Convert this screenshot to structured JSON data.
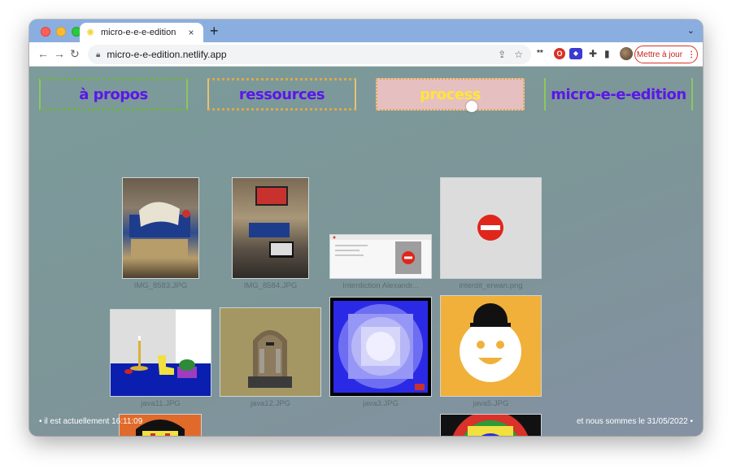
{
  "browser": {
    "tab_title": "micro-e-e-e-edition",
    "new_tab_symbol": "+",
    "url": "micro-e-e-edition.netlify.app",
    "update_button": "Mettre à jour"
  },
  "nav": {
    "items": [
      {
        "label": "à propos"
      },
      {
        "label": "ressources"
      },
      {
        "label": "process"
      },
      {
        "label": "micro-e-e-edition"
      }
    ]
  },
  "gallery": {
    "captions": [
      "IMG_8583.JPG",
      "IMG_8584.JPG",
      "Interdiction Alexandr...",
      "interdit_erwan.png",
      "java11.JPG",
      "java12.JPG",
      "java3.JPG",
      "java5.JPG"
    ]
  },
  "footer": {
    "time_text": "• il est actuellement 16:11:09",
    "date_text": "et nous sommes le 31/05/2022 •"
  },
  "colors": {
    "nav_text": "#5b17e8",
    "nav_active_bg": "#e6c0c0",
    "nav_active_text": "#ffe53b",
    "page_bg": "#7e979b"
  }
}
